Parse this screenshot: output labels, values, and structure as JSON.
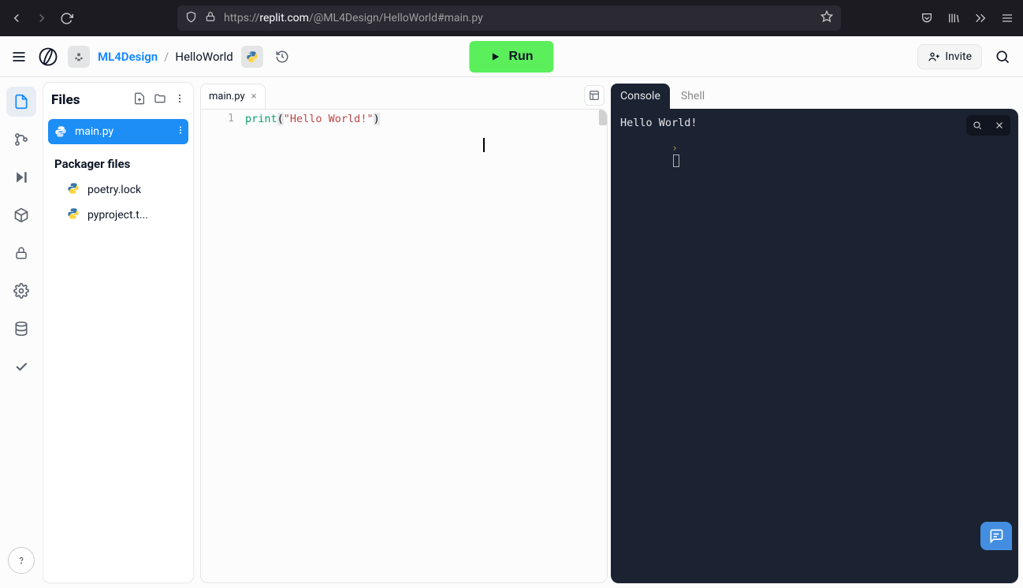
{
  "browser": {
    "url_prefix": "https://",
    "url_host_bold": "replit.com",
    "url_path": "/@ML4Design/HelloWorld#main.py"
  },
  "header": {
    "owner": "ML4Design",
    "separator": "/",
    "project": "HelloWorld",
    "run_label": "Run",
    "invite_label": "Invite"
  },
  "files": {
    "title": "Files",
    "active_file": "main.py",
    "packager_title": "Packager files",
    "pkg_items": [
      "poetry.lock",
      "pyproject.t..."
    ]
  },
  "editor": {
    "tab_name": "main.py",
    "line_number": "1",
    "code_fn": "print",
    "code_open": "(",
    "code_str": "\"Hello World!\"",
    "code_close": ")"
  },
  "console": {
    "tabs": [
      "Console",
      "Shell"
    ],
    "output": "Hello World!",
    "prompt": "›"
  }
}
